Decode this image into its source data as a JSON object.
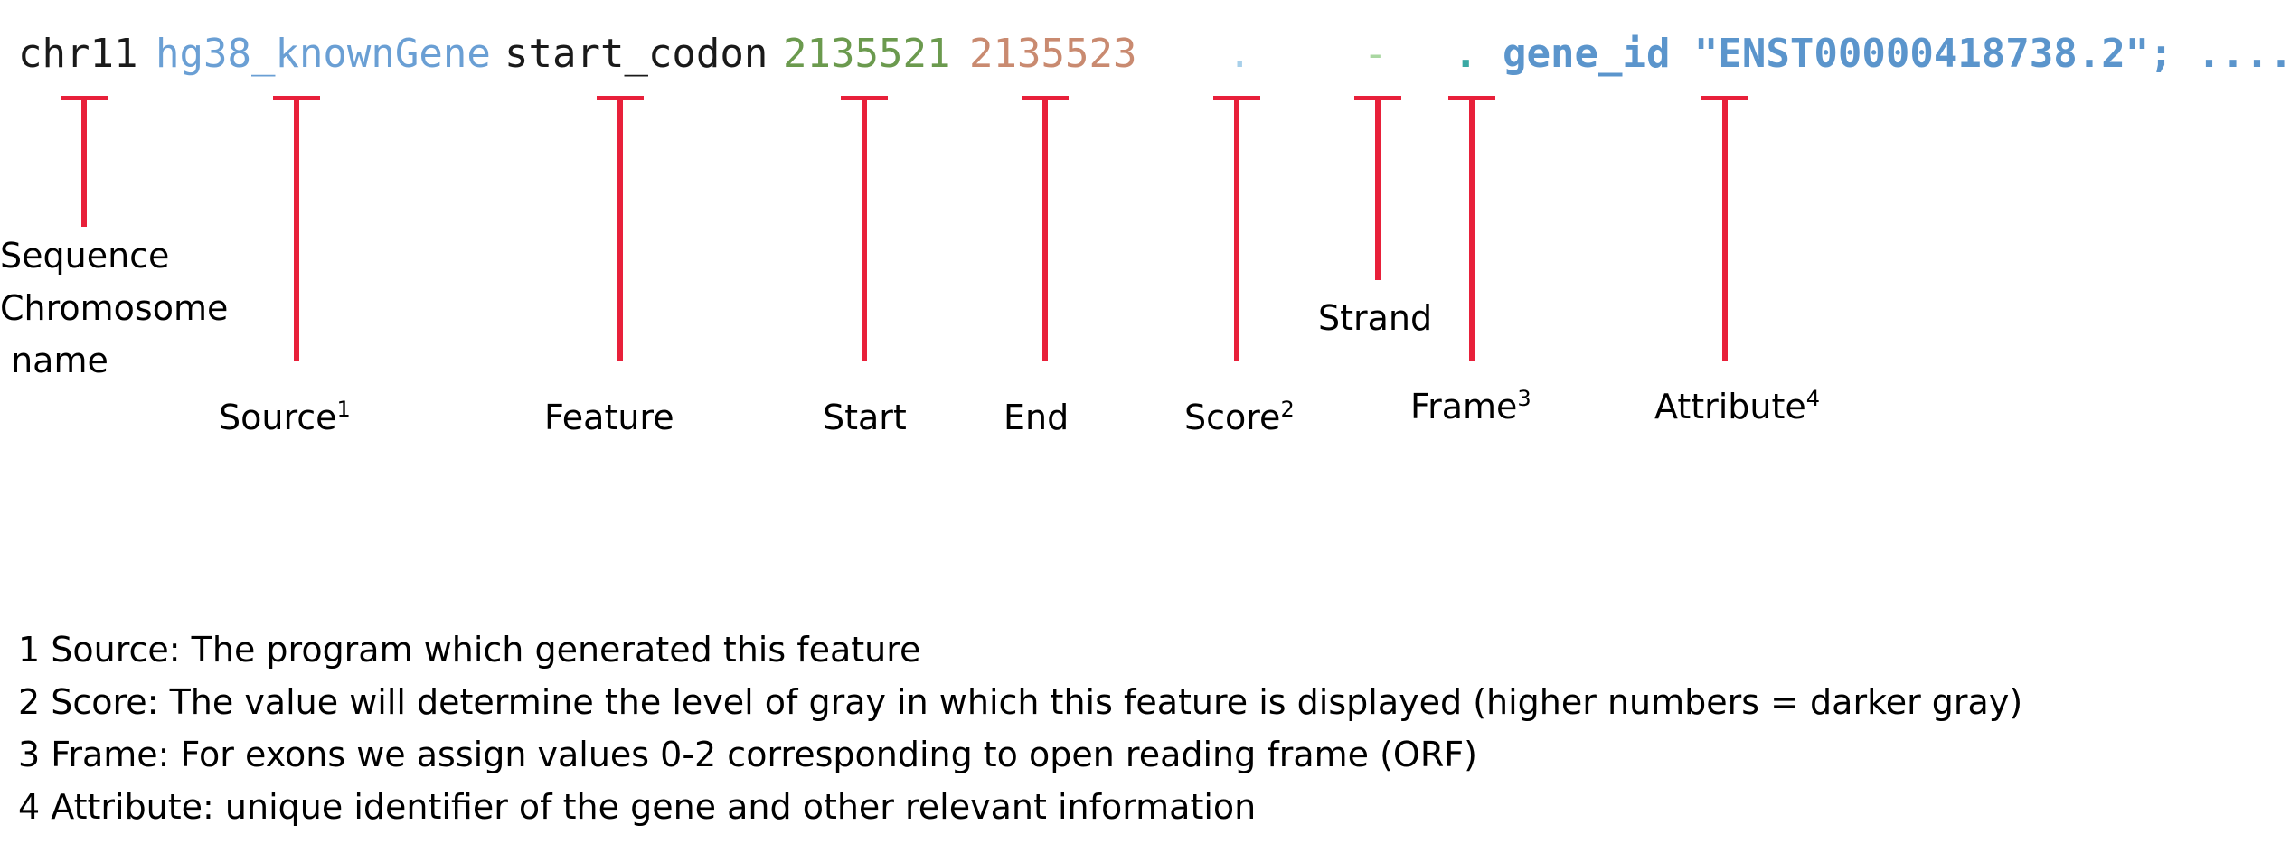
{
  "gtf_record": {
    "seqname": "chr11",
    "source": "hg38_knownGene",
    "feature": "start_codon",
    "start": "2135521",
    "end": "2135523",
    "score": ".",
    "strand": "-",
    "frame": ".",
    "attribute": "gene_id \"ENST00000418738.2\"; ......"
  },
  "colors": {
    "seqname": "#1a1a1a",
    "source": "#6a9fd4",
    "feature": "#1a1a1a",
    "start": "#6b9a4e",
    "end": "#c98a70",
    "score": "#a8d0ea",
    "strand": "#a9d7a1",
    "frame": "#3aa9a4",
    "attribute": "#5b95cc",
    "marker": "#e8203a"
  },
  "annotations": {
    "seqname_line1": "Sequence",
    "seqname_line2": "Chromosome",
    "seqname_line3": " name",
    "source": "Source",
    "source_sup": "1",
    "feature": "Feature",
    "start": "Start",
    "end": "End",
    "score": "Score",
    "score_sup": "2",
    "strand": "Strand",
    "frame": "Frame",
    "frame_sup": "3",
    "attribute": "Attribute",
    "attribute_sup": "4"
  },
  "footnotes": [
    "1 Source: The program which generated this feature",
    "2 Score: The value will determine the level of gray in which this feature is displayed (higher numbers = darker gray)",
    "3 Frame: For exons we assign values 0-2 corresponding to open reading frame (ORF)",
    "4 Attribute: unique identifier of the gene and other relevant information"
  ]
}
